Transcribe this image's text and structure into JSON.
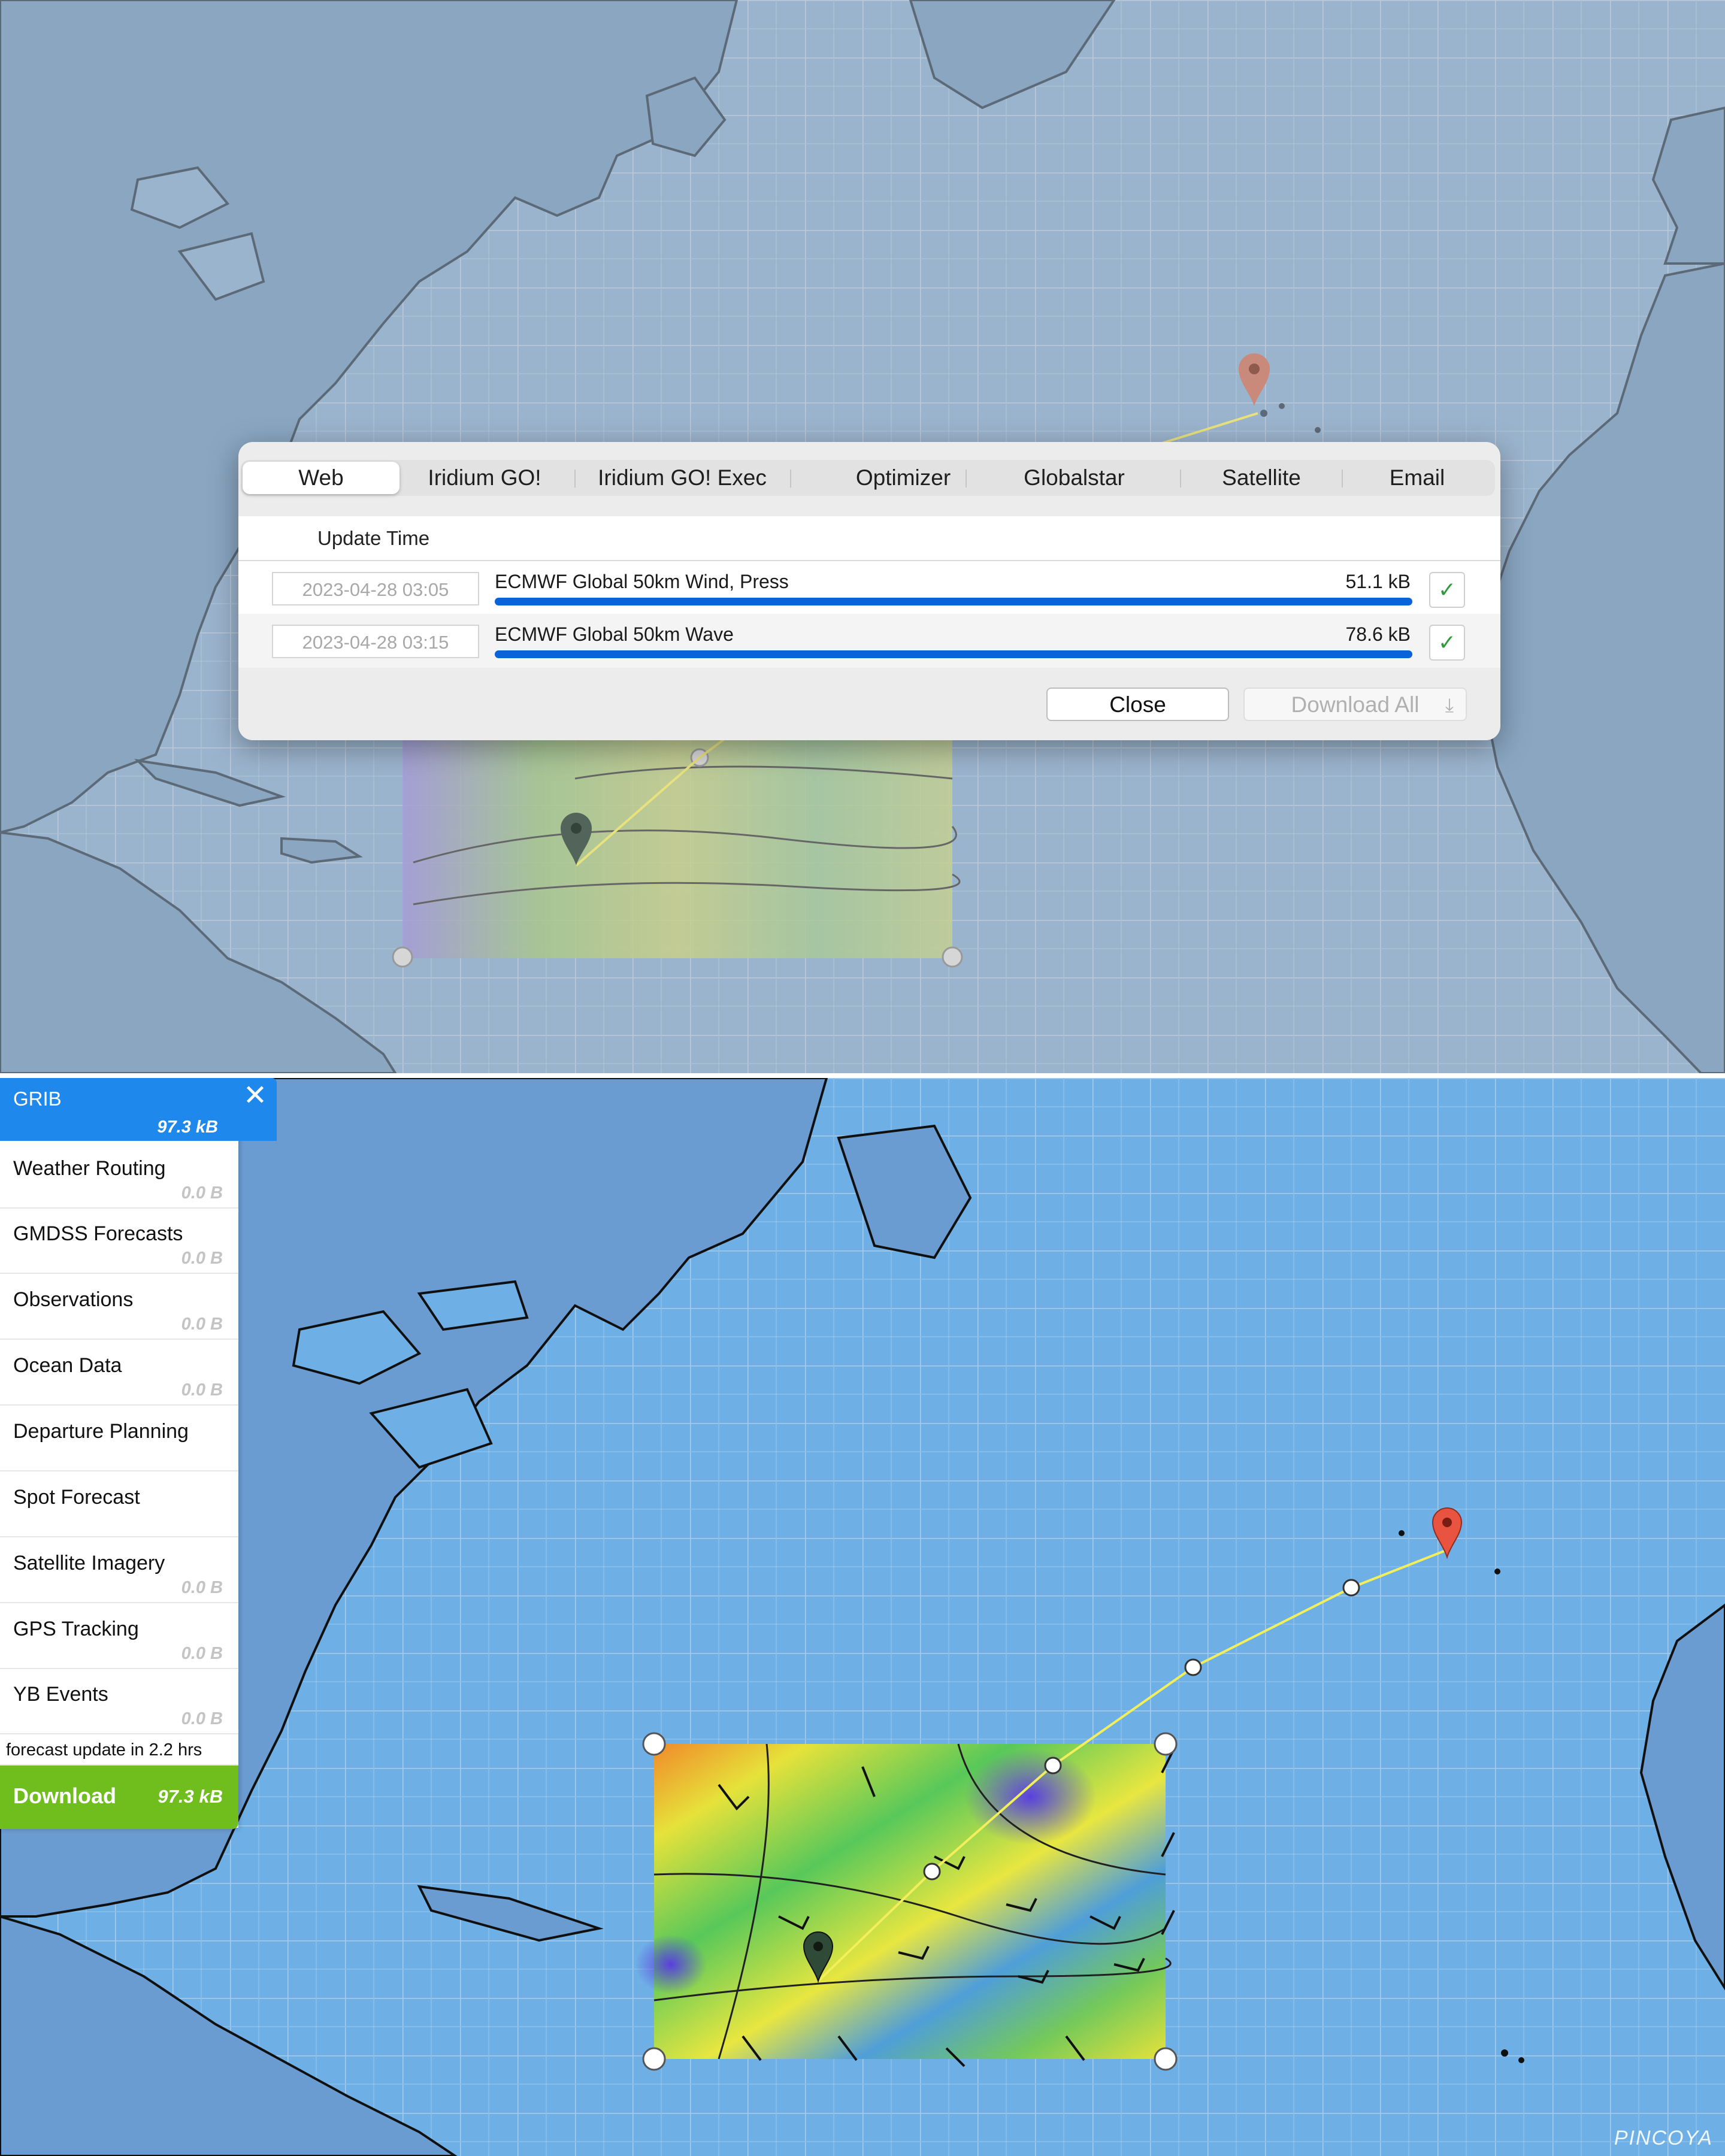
{
  "dialog": {
    "tabs": [
      "Web",
      "Iridium GO!",
      "Iridium GO! Exec",
      "Optimizer",
      "Globalstar",
      "Satellite",
      "Email"
    ],
    "active_tab": "Web",
    "column_header": "Update Time",
    "files": [
      {
        "update_time": "2023-04-28 03:05",
        "name": "ECMWF Global 50km Wind, Press",
        "size": "51.1 kB",
        "progress": 1.0,
        "done": true
      },
      {
        "update_time": "2023-04-28 03:15",
        "name": "ECMWF Global 50km Wave",
        "size": "78.6 kB",
        "progress": 1.0,
        "done": true
      }
    ],
    "close_label": "Close",
    "download_all_label": "Download All",
    "check_glyph": "✓",
    "download_icon": "download-arrow-icon",
    "download_glyph": "⤓"
  },
  "sidebar": {
    "grib": {
      "title": "GRIB",
      "size": "97.3 kB",
      "close_glyph": "✕"
    },
    "items": [
      {
        "label": "Weather Routing",
        "size": "0.0 B"
      },
      {
        "label": "GMDSS Forecasts",
        "size": "0.0 B"
      },
      {
        "label": "Observations",
        "size": "0.0 B"
      },
      {
        "label": "Ocean Data",
        "size": "0.0 B"
      },
      {
        "label": "Departure Planning",
        "size": ""
      },
      {
        "label": "Spot Forecast",
        "size": ""
      },
      {
        "label": "Satellite Imagery",
        "size": "0.0 B"
      },
      {
        "label": "GPS Tracking",
        "size": "0.0 B"
      },
      {
        "label": "YB Events",
        "size": "0.0 B"
      }
    ],
    "forecast_note": "forecast update in 2.2 hrs",
    "download": {
      "label": "Download",
      "size": "97.3 kB"
    }
  },
  "map": {
    "start_marker": "map-pin-icon",
    "destination_marker": "map-pin-icon",
    "route_color": "#f2ef5a",
    "destination_pin_color": "#e8543f",
    "start_pin_color": "#2f4a36"
  },
  "watermark": "PINCOYA"
}
